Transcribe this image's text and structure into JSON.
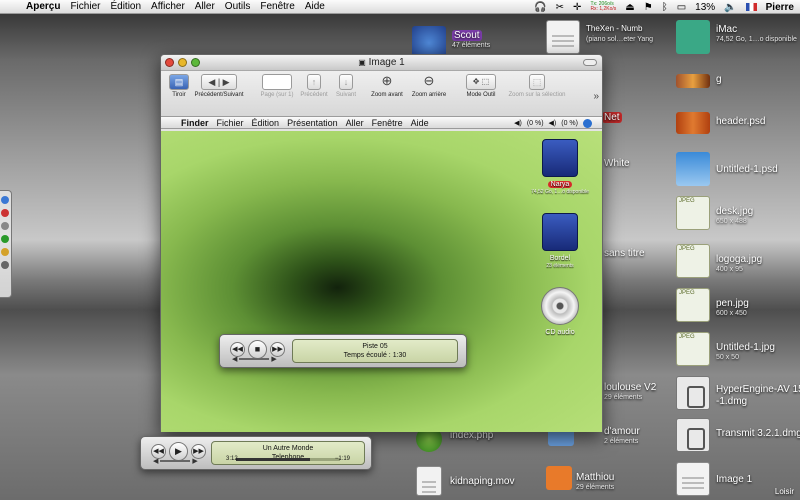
{
  "menubar": {
    "app": "Aperçu",
    "items": [
      "Fichier",
      "Édition",
      "Afficher",
      "Aller",
      "Outils",
      "Fenêtre",
      "Aide"
    ],
    "net_tx": "Tx:",
    "net_rx": "Rx:",
    "net_tx_val": "206o/s",
    "net_rx_val": "1,2Ko/s",
    "battery": "13%",
    "user": "Pierre"
  },
  "desktop": {
    "icons": [
      {
        "name": "Scout",
        "sub": "47 éléments",
        "icon": "tent-icon"
      },
      {
        "name": "TheXen - Numb",
        "sub": "(piano sol…eter Yang",
        "icon": "pdf-icon"
      },
      {
        "name": "iMac",
        "sub": "74,52 Go, 1…o disponible",
        "icon": "imac-icon"
      },
      {
        "name": "g",
        "sub": "",
        "icon": "image-strip-icon"
      },
      {
        "name": "header.psd",
        "sub": "",
        "icon": "psd-icon"
      },
      {
        "name": "Untitled-1.psd",
        "sub": "",
        "icon": "psd-icon"
      },
      {
        "name": "desk.jpg",
        "sub": "650 x 488",
        "icon": "jpeg-icon"
      },
      {
        "name": "logoga.jpg",
        "sub": "400 x 95",
        "icon": "jpeg-icon"
      },
      {
        "name": "pen.jpg",
        "sub": "600 x 450",
        "icon": "jpeg-icon"
      },
      {
        "name": "Untitled-1.jpg",
        "sub": "50 x 50",
        "icon": "jpeg-icon"
      },
      {
        "name": "HyperEngine-AV 15",
        "sub": "-1.dmg",
        "icon": "dmg-icon"
      },
      {
        "name": "Transmit 3.2.1.dmg",
        "sub": "",
        "icon": "dmg-icon"
      },
      {
        "name": "Image 1",
        "sub": "",
        "icon": "pdf-icon"
      },
      {
        "name": "index.php",
        "sub": "",
        "icon": "php-icon"
      },
      {
        "name": "kidnaping.mov",
        "sub": "",
        "icon": "mov-icon"
      },
      {
        "name": "Matthiou",
        "sub": "29 éléments",
        "icon": "folder-icon"
      },
      {
        "name": "d'amour",
        "sub": "2 éléments",
        "icon": "folder-icon"
      },
      {
        "name": "loulouse V2",
        "sub": "29 éléments",
        "icon": "folder-icon"
      },
      {
        "name": "sans titre",
        "sub": "",
        "icon": "folder-icon"
      },
      {
        "name": "White",
        "sub": "",
        "icon": "folder-icon"
      },
      {
        "name": "Net",
        "sub": "",
        "icon": "folder-icon"
      }
    ],
    "loisir": "Loisir"
  },
  "window": {
    "title": "Image 1",
    "toolbar": [
      {
        "label": "Tiroir",
        "glyph": "▤",
        "disabled": false
      },
      {
        "label": "Précédent/Suivant",
        "glyph": "◀ | ▶",
        "disabled": false
      },
      {
        "label": "Page (sur 1)",
        "glyph": "",
        "disabled": true
      },
      {
        "label": "Précédent",
        "glyph": "↑",
        "disabled": true
      },
      {
        "label": "Suivant",
        "glyph": "↓",
        "disabled": true
      },
      {
        "label": "Zoom avant",
        "glyph": "⊕",
        "disabled": false
      },
      {
        "label": "Zoom arrière",
        "glyph": "⊖",
        "disabled": false
      },
      {
        "label": "Mode Outil",
        "glyph": "✥ ⬚",
        "disabled": false
      },
      {
        "label": "Zoom sur la sélection",
        "glyph": "⬚",
        "disabled": true
      }
    ],
    "more": "»"
  },
  "inner": {
    "app": "Finder",
    "items": [
      "Fichier",
      "Édition",
      "Présentation",
      "Aller",
      "Fenêtre",
      "Aide"
    ],
    "vol1": "(0 %)",
    "vol2": "(0 %)",
    "volumes": [
      {
        "name": "Narya",
        "sub": "74,52 Go, 1…o disponible",
        "highlight": true,
        "kind": "drive"
      },
      {
        "name": "Bordel",
        "sub": "23 éléments",
        "highlight": false,
        "kind": "drive"
      },
      {
        "name": "CD audio",
        "sub": "",
        "highlight": false,
        "kind": "cd"
      }
    ]
  },
  "player_inner": {
    "line1": "Piste 05",
    "line2": "Temps écoulé : 1:30",
    "prev": "◀◀",
    "stop": "■",
    "next": "▶▶"
  },
  "player_desktop": {
    "line1": "Un Autre Monde",
    "line2": "Telephone",
    "elapsed": "3:12",
    "remaining": "−1:19",
    "progress": 0.71,
    "prev": "◀◀",
    "play": "▶",
    "next": "▶▶"
  }
}
